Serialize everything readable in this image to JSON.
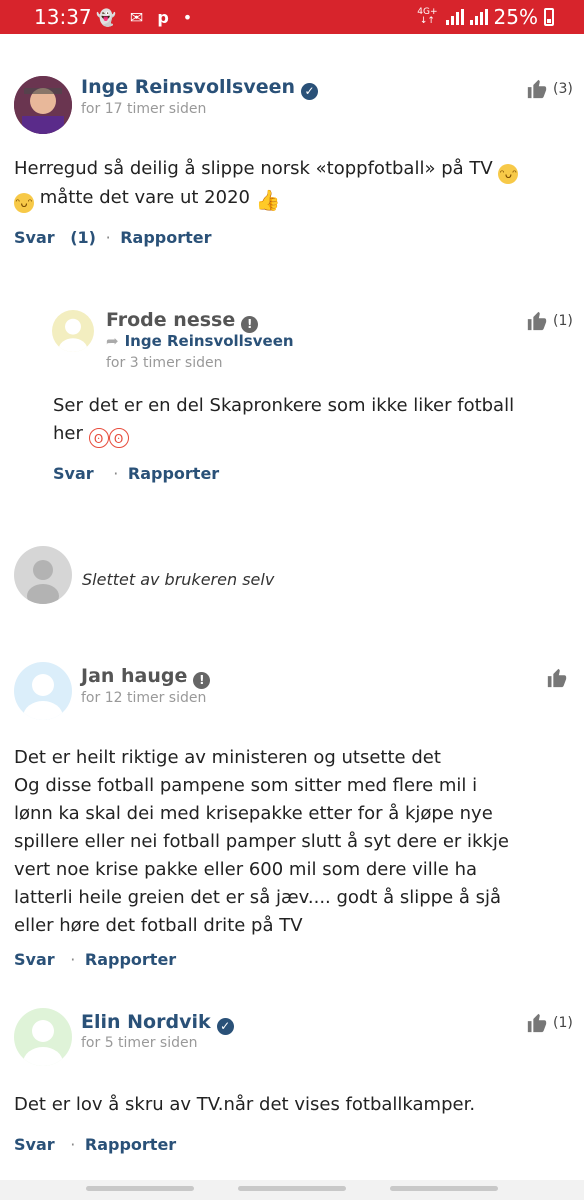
{
  "status_bar": {
    "time": "13:37",
    "network": "4G+",
    "battery": "25%",
    "color": "#d7242c"
  },
  "comments": [
    {
      "name": "Inge Reinsvollsveen",
      "time": "for 17 timer siden",
      "likes": "(3)",
      "body_text_1": "Herregud så deilig å slippe norsk «toppfotball» på TV",
      "body_text_2": "måtte det vare ut 2020",
      "reply_label": "Svar",
      "reply_count": "(1)",
      "report_label": "Rapporter"
    },
    {
      "name": "Frode nesse",
      "reply_to": "Inge Reinsvollsveen",
      "time": "for 3 timer siden",
      "likes": "(1)",
      "body_line_1": "Ser det er en del Skapronkere som ikke liker fotball",
      "body_line_2": "her",
      "reply_label": "Svar",
      "report_label": "Rapporter"
    },
    {
      "deleted_text": "Slettet av brukeren selv"
    },
    {
      "name": "Jan hauge",
      "time": "for 12 timer siden",
      "body_lines": [
        "Det er heilt riktige av ministeren og utsette det",
        "Og disse fotball pampene som sitter med flere mil i",
        "lønn ka skal dei med krisepakke etter for å kjøpe nye",
        "spillere eller nei fotball pamper slutt å syt dere er ikkje",
        "vert noe krise pakke eller 600 mil som dere ville ha",
        "latterli heile greien  det er så jæv.... godt å slippe å sjå",
        "eller høre det fotball drite på TV"
      ],
      "reply_label": "Svar",
      "report_label": "Rapporter"
    },
    {
      "name": "Elin Nordvik",
      "time": "for 5 timer siden",
      "likes": "(1)",
      "body": "Det er lov å skru av TV.når det vises fotballkamper.",
      "reply_label": "Svar",
      "report_label": "Rapporter"
    }
  ],
  "colors": {
    "name_blue": "#2a5178",
    "text": "#222222",
    "muted": "#999999"
  }
}
